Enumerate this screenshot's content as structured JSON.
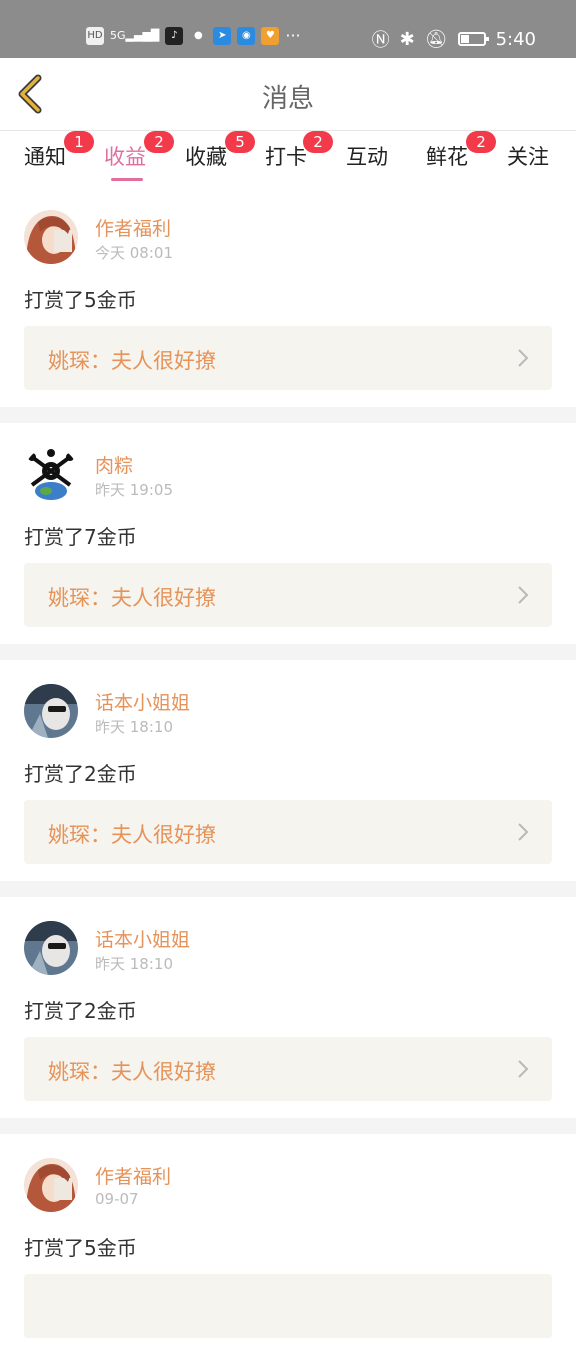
{
  "status_bar": {
    "left_icons": [
      "hd-icon",
      "5g-signal-icon",
      "tiktok-icon",
      "qq-icon",
      "telegram-icon",
      "bulb-app-icon",
      "heart-app-icon",
      "more-icon"
    ],
    "time": "5:40",
    "battery_level": 0.35
  },
  "header": {
    "title": "消息"
  },
  "tabs": [
    {
      "label": "通知",
      "badge": "1",
      "active": false
    },
    {
      "label": "收益",
      "badge": "2",
      "active": true
    },
    {
      "label": "收藏",
      "badge": "5",
      "active": false
    },
    {
      "label": "打卡",
      "badge": "2",
      "active": false
    },
    {
      "label": "互动",
      "badge": "",
      "active": false
    },
    {
      "label": "鲜花",
      "badge": "2",
      "active": false
    },
    {
      "label": "关注",
      "badge": "",
      "active": false
    }
  ],
  "messages": [
    {
      "name": "作者福利",
      "time": "今天 08:01",
      "text": "打赏了5金币",
      "book": "姚琛：夫人很好撩"
    },
    {
      "name": "肉粽",
      "time": "昨天 19:05",
      "text": "打赏了7金币",
      "book": "姚琛：夫人很好撩"
    },
    {
      "name": "话本小姐姐",
      "time": "昨天 18:10",
      "text": "打赏了2金币",
      "book": "姚琛：夫人很好撩"
    },
    {
      "name": "话本小姐姐",
      "time": "昨天 18:10",
      "text": "打赏了2金币",
      "book": "姚琛：夫人很好撩"
    },
    {
      "name": "作者福利",
      "time": "09-07",
      "text": "打赏了5金币",
      "book": ""
    }
  ],
  "colors": {
    "accent_pink": "#e06fa0",
    "name_orange": "#e6935a",
    "badge_red": "#f23a4a",
    "back_arrow": "#e2b23a"
  }
}
